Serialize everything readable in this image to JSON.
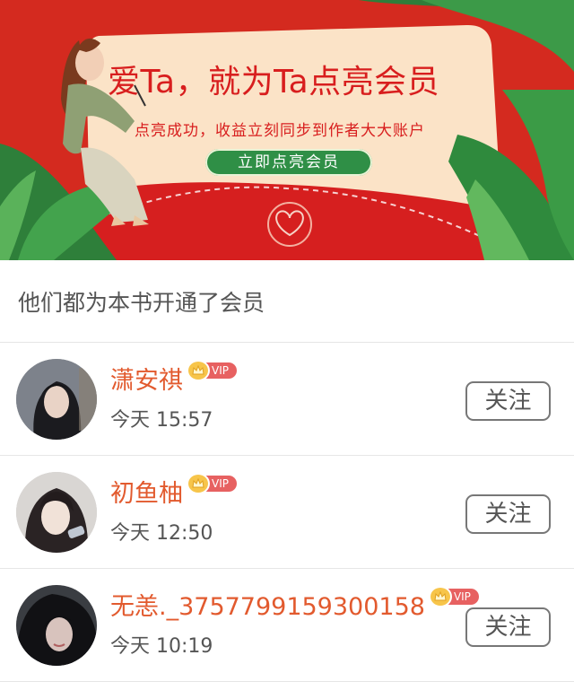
{
  "banner": {
    "title": "爱Ta，就为Ta点亮会员",
    "subtitle": "点亮成功，收益立刻同步到作者大大账户",
    "cta_label": "立即点亮会员"
  },
  "section": {
    "title": "他们都为本书开通了会员"
  },
  "vip_label": "VIP",
  "follow_label": "关注",
  "members": [
    {
      "name": "潇安祺",
      "time": "今天 15:57"
    },
    {
      "name": "初鱼柚",
      "time": "今天 12:50"
    },
    {
      "name": "无恙._3757799159300158",
      "time": "今天 10:19"
    }
  ],
  "colors": {
    "banner_red": "#d42a1f",
    "card_cream": "#fbe3c7",
    "cta_green": "#2f8f46",
    "name_orange": "#e25a2e",
    "vip_red": "#e76161",
    "crown_gold": "#f7c54a"
  },
  "icons": [
    "crown-icon",
    "heart-seal-icon"
  ]
}
